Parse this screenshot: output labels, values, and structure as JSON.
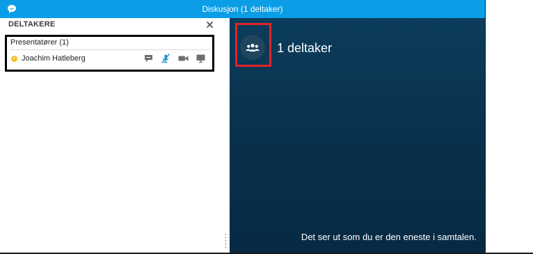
{
  "titlebar": {
    "title": "Diskusjon (1 deltaker)"
  },
  "panel": {
    "title": "DELTAKERE",
    "close_symbol": "×",
    "group_label": "Presentatører (1)",
    "participants": [
      {
        "name": "Joachim Hatleberg",
        "status_color": "#f5c021"
      }
    ]
  },
  "stage": {
    "count_label": "1 deltaker",
    "alone_message": "Det ser ut som du er den eneste i samtalen."
  },
  "colors": {
    "titlebar": "#0b9ee6",
    "stage_bg": "#0a3652",
    "highlight_black": "#000000",
    "highlight_red": "#e3242b"
  },
  "icons": [
    "skype-logo-icon",
    "close-icon",
    "status-away-icon",
    "chat-bubble-icon",
    "microphone-muted-icon",
    "video-camera-icon",
    "screen-share-icon",
    "people-icon",
    "splitter-grip-icon"
  ]
}
